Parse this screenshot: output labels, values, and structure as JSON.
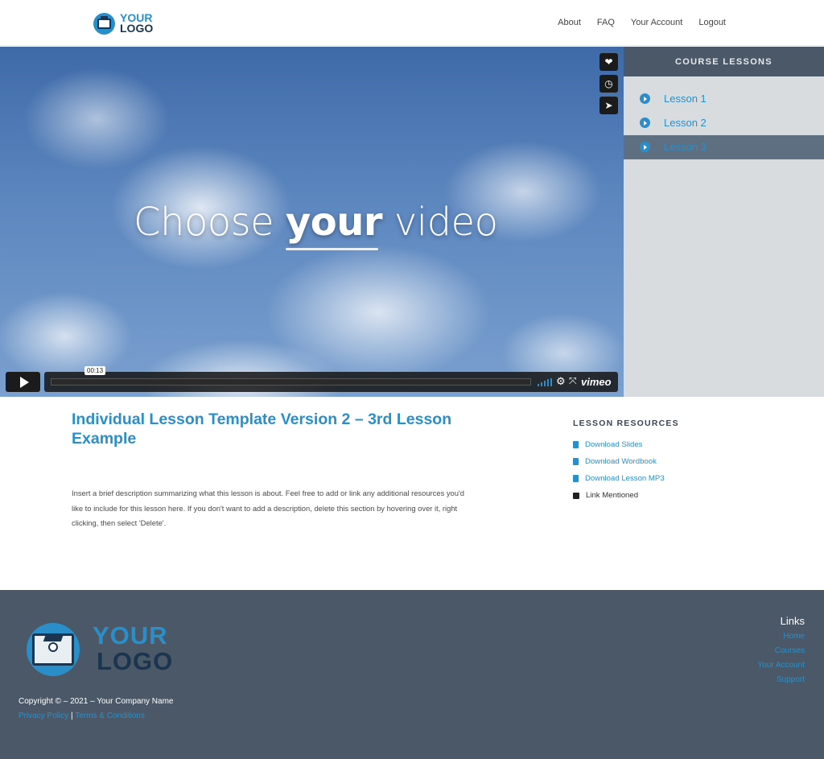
{
  "header": {
    "logo": {
      "line1": "YOUR",
      "line2": "LOGO"
    },
    "nav": [
      "About",
      "FAQ",
      "Your Account",
      "Logout"
    ]
  },
  "video": {
    "title_pre": "Choose ",
    "title_bold": "your",
    "title_post": " video",
    "time": "00:13",
    "brand": "vimeo",
    "side_icons": [
      "heart-icon",
      "clock-icon",
      "send-icon"
    ]
  },
  "course": {
    "heading": "COURSE LESSONS",
    "lessons": [
      {
        "label": "Lesson 1",
        "active": false
      },
      {
        "label": "Lesson 2",
        "active": false
      },
      {
        "label": "Lesson 3",
        "active": true
      }
    ]
  },
  "content": {
    "title": "Individual Lesson Template Version 2 – 3rd Lesson Example",
    "description": "Insert a brief description summarizing what this lesson is about. Feel free to add or link any additional resources you'd like to include for this lesson here. If you don't want to add a description, delete this section by hovering over it, right clicking, then select 'Delete'."
  },
  "resources": {
    "heading": "LESSON RESOURCES",
    "items": [
      "Download Slides",
      "Download Wordbook",
      "Download Lesson MP3",
      "Link Mentioned"
    ]
  },
  "footer": {
    "logo": {
      "line1": "YOUR",
      "line2": "LOGO"
    },
    "copyright": "Copyright © – 2021 – Your Company Name",
    "privacy": "Privacy Policy",
    "separator": "|",
    "terms": "Terms & Conditions",
    "links_heading": "Links",
    "links": [
      "Home",
      "Courses",
      "Your Account",
      "Support"
    ]
  },
  "colors": {
    "accent": "#2a8fc9",
    "navy": "#1b3550",
    "panel": "#4a5867",
    "lesson_bg": "#d9dcdf"
  }
}
